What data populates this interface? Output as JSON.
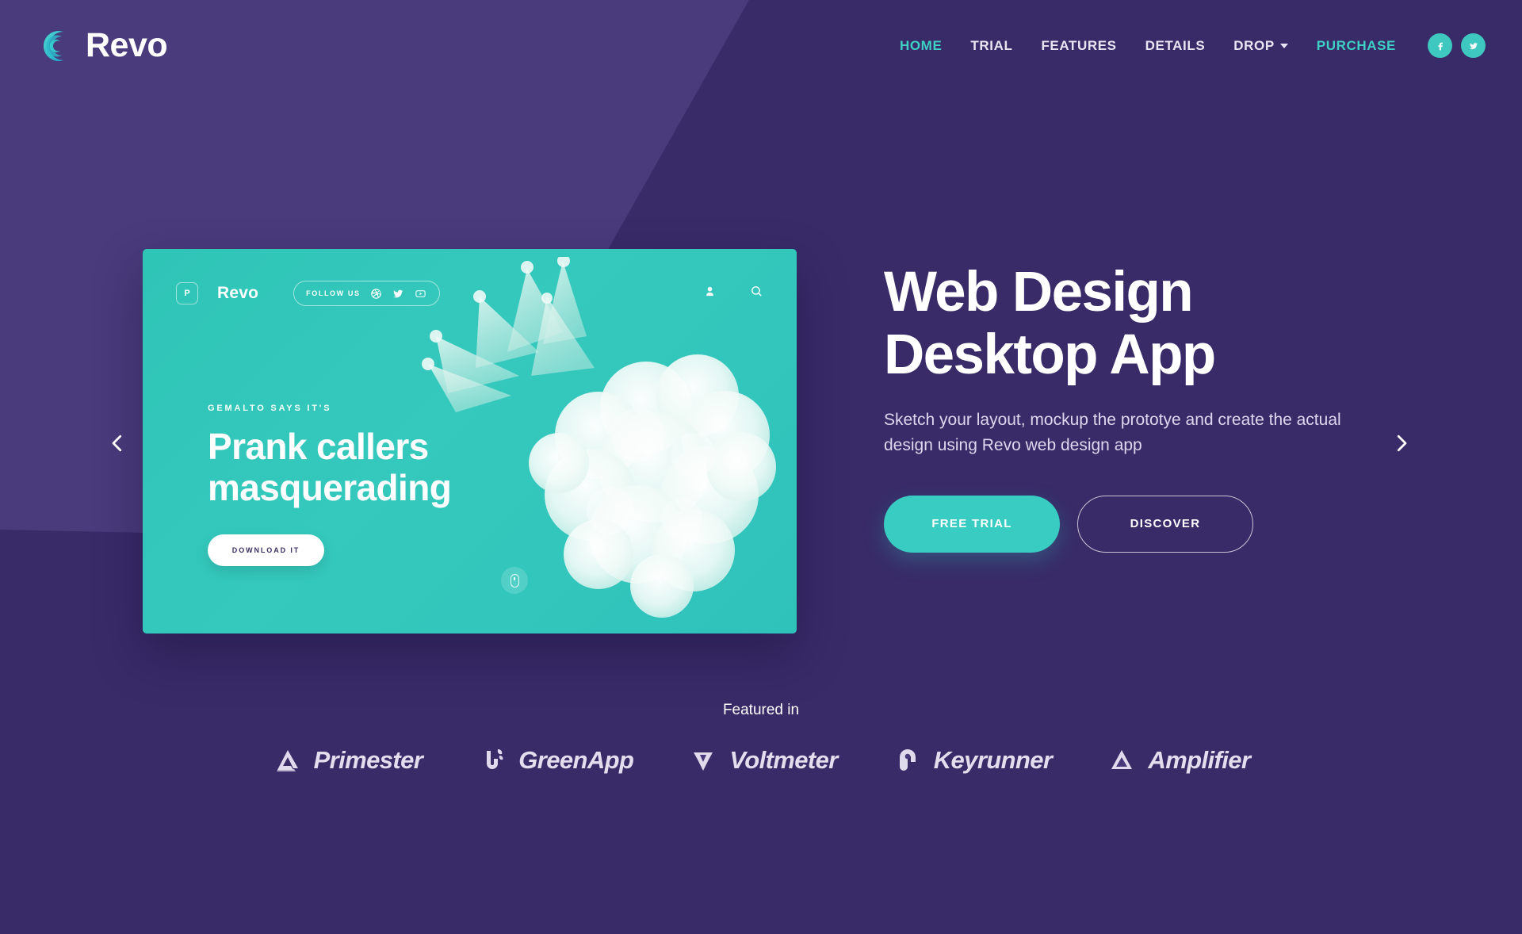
{
  "brand": {
    "name": "Revo",
    "logo_icon": "revo-crescent-logo"
  },
  "nav": {
    "items": [
      {
        "label": "HOME",
        "state": "active"
      },
      {
        "label": "TRIAL",
        "state": "default"
      },
      {
        "label": "FEATURES",
        "state": "default"
      },
      {
        "label": "DETAILS",
        "state": "default"
      },
      {
        "label": "DROP",
        "state": "dropdown"
      },
      {
        "label": "PURCHASE",
        "state": "accent"
      }
    ],
    "social": [
      {
        "name": "facebook-icon",
        "glyph": "f"
      },
      {
        "name": "twitter-icon",
        "glyph": "t"
      }
    ]
  },
  "slider": {
    "prev_label": "Previous slide",
    "next_label": "Next slide",
    "card": {
      "logo_letter": "P",
      "brand": "Revo",
      "follow_label": "FOLLOW US",
      "follow_icons": [
        "dribbble-icon",
        "twitter-icon",
        "youtube-icon"
      ],
      "top_icons": [
        "user-icon",
        "search-icon"
      ],
      "kicker": "GEMALTO SAYS IT'S",
      "title": "Prank callers masquerading",
      "button": "DOWNLOAD IT",
      "scroll_hint": "mouse-scroll-icon"
    }
  },
  "hero": {
    "title_line1": "Web Design",
    "title_line2": "Desktop App",
    "subtitle": "Sketch your layout, mockup the prototye and create the actual design using Revo web design app",
    "primary_button": "FREE TRIAL",
    "secondary_button": "DISCOVER"
  },
  "featured": {
    "label": "Featured in",
    "logos": [
      {
        "name": "Primester",
        "icon": "primester-delta-icon"
      },
      {
        "name": "GreenApp",
        "icon": "greenapp-sprout-icon"
      },
      {
        "name": "Voltmeter",
        "icon": "voltmeter-shield-icon"
      },
      {
        "name": "Keyrunner",
        "icon": "keyrunner-loop-icon"
      },
      {
        "name": "Amplifier",
        "icon": "amplifier-triangle-icon"
      }
    ]
  },
  "colors": {
    "bg_dark": "#382b68",
    "bg_light": "#493b7c",
    "accent_teal": "#3ecdc4",
    "card_teal": "#2ec4b6",
    "text_light": "#ffffff"
  }
}
